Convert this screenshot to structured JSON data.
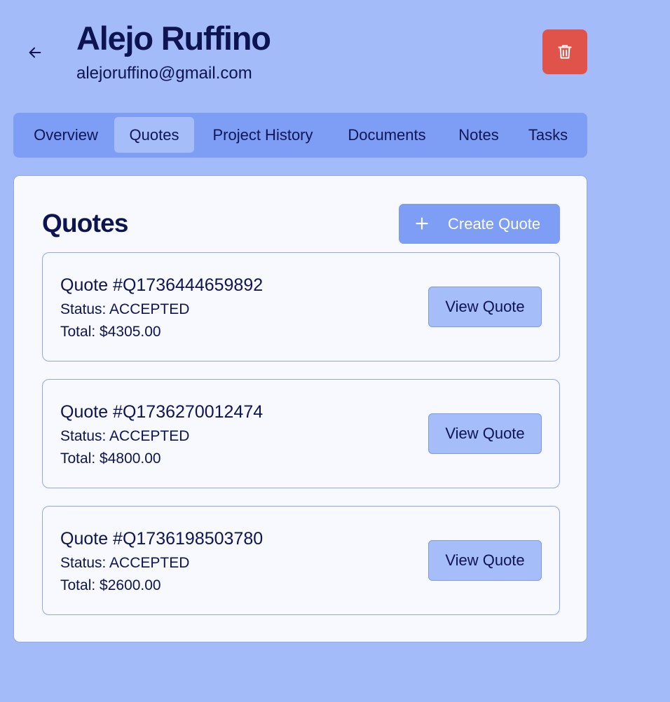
{
  "header": {
    "name": "Alejo Ruffino",
    "email": "alejoruffino@gmail.com",
    "back_icon": "arrow-left-icon",
    "delete_icon": "trash-icon",
    "delete_color": "#e0534b"
  },
  "tabs": [
    {
      "label": "Overview",
      "active": false
    },
    {
      "label": "Quotes",
      "active": true
    },
    {
      "label": "Project History",
      "active": false
    },
    {
      "label": "Documents",
      "active": false
    },
    {
      "label": "Notes",
      "active": false
    },
    {
      "label": "Tasks",
      "active": false
    }
  ],
  "quotes_section": {
    "title": "Quotes",
    "create_label": "Create Quote",
    "create_icon": "plus-icon",
    "items": [
      {
        "title": "Quote #Q1736444659892",
        "status": "Status: ACCEPTED",
        "total": "Total: $4305.00",
        "action": "View Quote"
      },
      {
        "title": "Quote #Q1736270012474",
        "status": "Status: ACCEPTED",
        "total": "Total: $4800.00",
        "action": "View Quote"
      },
      {
        "title": "Quote #Q1736198503780",
        "status": "Status: ACCEPTED",
        "total": "Total: $2600.00",
        "action": "View Quote"
      }
    ]
  },
  "colors": {
    "background": "#a3bcf9",
    "accent": "#7e9df4",
    "text": "#0e1452"
  }
}
